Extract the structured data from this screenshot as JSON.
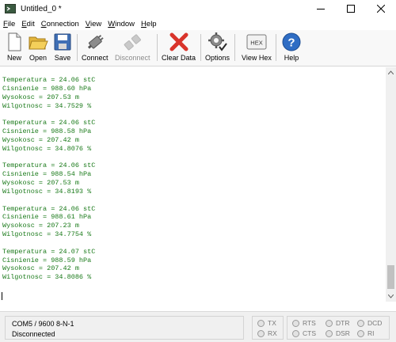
{
  "window": {
    "title": "Untitled_0 *"
  },
  "menu": [
    {
      "accel": "F",
      "rest": "ile"
    },
    {
      "accel": "E",
      "rest": "dit"
    },
    {
      "accel": "C",
      "rest": "onnection"
    },
    {
      "accel": "V",
      "rest": "iew"
    },
    {
      "accel": "W",
      "rest": "indow"
    },
    {
      "accel": "H",
      "rest": "elp"
    }
  ],
  "toolbar": {
    "new": "New",
    "open": "Open",
    "save": "Save",
    "connect": "Connect",
    "disconnect": "Disconnect",
    "clear": "Clear Data",
    "options": "Options",
    "view_hex": "View Hex",
    "hex_badge": "HEX",
    "help": "Help"
  },
  "terminal": {
    "text_color": "#1a7a1a",
    "readings": [
      [
        "Temperatura = 24.06 stC",
        "Cisnienie = 988.60 hPa",
        "Wysokosc = 207.53 m",
        "Wilgotnosc = 34.7529 %"
      ],
      [
        "Temperatura = 24.06 stC",
        "Cisnienie = 988.58 hPa",
        "Wysokosc = 207.42 m",
        "Wilgotnosc = 34.8076 %"
      ],
      [
        "Temperatura = 24.06 stC",
        "Cisnienie = 988.54 hPa",
        "Wysokosc = 207.53 m",
        "Wilgotnosc = 34.8193 %"
      ],
      [
        "Temperatura = 24.06 stC",
        "Cisnienie = 988.61 hPa",
        "Wysokosc = 207.23 m",
        "Wilgotnosc = 34.7754 %"
      ],
      [
        "Temperatura = 24.07 stC",
        "Cisnienie = 988.59 hPa",
        "Wysokosc = 207.42 m",
        "Wilgotnosc = 34.8086 %"
      ]
    ]
  },
  "status": {
    "port": "COM5 / 9600 8-N-1",
    "state": "Disconnected"
  },
  "signals": {
    "tx": "TX",
    "rx": "RX",
    "rts": "RTS",
    "cts": "CTS",
    "dtr": "DTR",
    "dsr": "DSR",
    "dcd": "DCD",
    "ri": "RI"
  }
}
